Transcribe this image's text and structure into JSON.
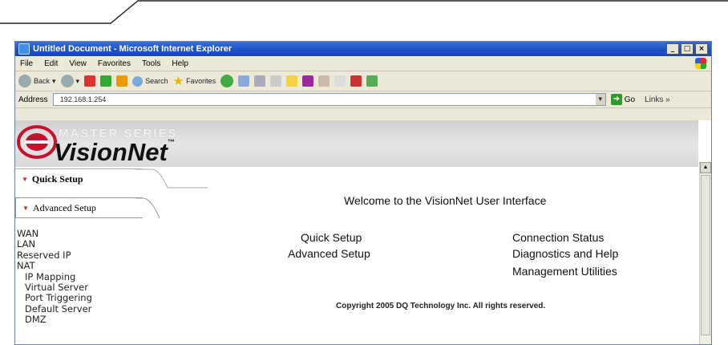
{
  "window": {
    "title": "Untitled Document - Microsoft Internet Explorer",
    "buttons": {
      "minimize": "_",
      "maximize": "□",
      "close": "×"
    }
  },
  "menu": [
    "File",
    "Edit",
    "View",
    "Favorites",
    "Tools",
    "Help"
  ],
  "toolbar": {
    "back": "Back",
    "search": "Search",
    "favorites": "Favorites"
  },
  "address": {
    "label": "Address",
    "value": "192.168.1.254",
    "go": "Go",
    "links": "Links »"
  },
  "banner": {
    "series": "MASTER SERIES",
    "product": "VisionNet",
    "tm": "™"
  },
  "tabs": {
    "quick": "Quick Setup",
    "advanced": "Advanced Setup"
  },
  "sidebar": {
    "items": [
      "WAN",
      "LAN",
      "Reserved IP",
      "NAT"
    ],
    "sub_items": [
      "IP Mapping",
      "Virtual Server",
      "Port Triggering",
      "Default Server",
      "DMZ"
    ]
  },
  "main": {
    "welcome": "Welcome to the VisionNet User Interface",
    "links": {
      "quick_setup": "Quick Setup",
      "advanced_setup": "Advanced Setup",
      "connection_status": "Connection Status",
      "diagnostics": "Diagnostics and Help",
      "management": "Management Utilities"
    },
    "copyright": "Copyright 2005 DQ Technology Inc. All rights reserved."
  },
  "colors": {
    "titlebar": "#1c4fc0",
    "logo_red": "#c8102e"
  }
}
